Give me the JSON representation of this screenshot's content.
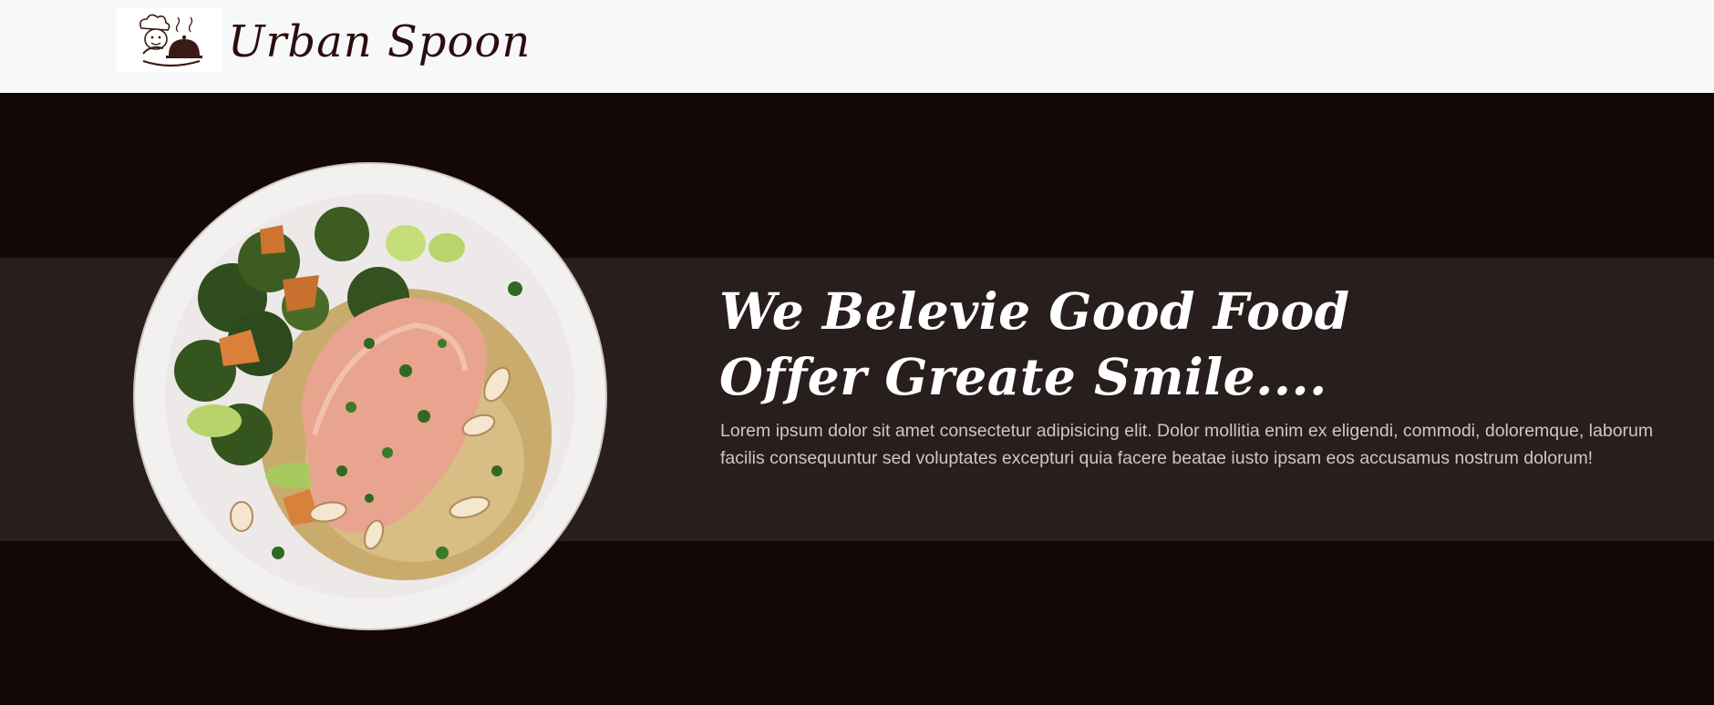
{
  "brand": {
    "name": "Urban Spoon",
    "logo_icon": "chef-cloche-icon"
  },
  "hero": {
    "headline_line1_regular": "We Belevie Good ",
    "headline_line1_bold": "Food",
    "headline_line2_regular": "Offer Greate ",
    "headline_line2_bold": "Smile....",
    "description": "Lorem ipsum dolor sit amet consectetur adipisicing elit. Dolor mollitia enim ex eligendi, commodi, doloremque, laborum facilis consequuntur sed voluptates excepturi quia facere beatae iusto ipsam eos accusamus nostrum dolorum!",
    "image_icon": "salmon-plate-image"
  },
  "colors": {
    "navbar_bg": "#f7f8fa",
    "hero_bg": "#140708",
    "band_bg": "#281e1e",
    "brand_text": "#2a0d0c",
    "headline": "#ffffff",
    "body_text": "#cfc7c4"
  }
}
